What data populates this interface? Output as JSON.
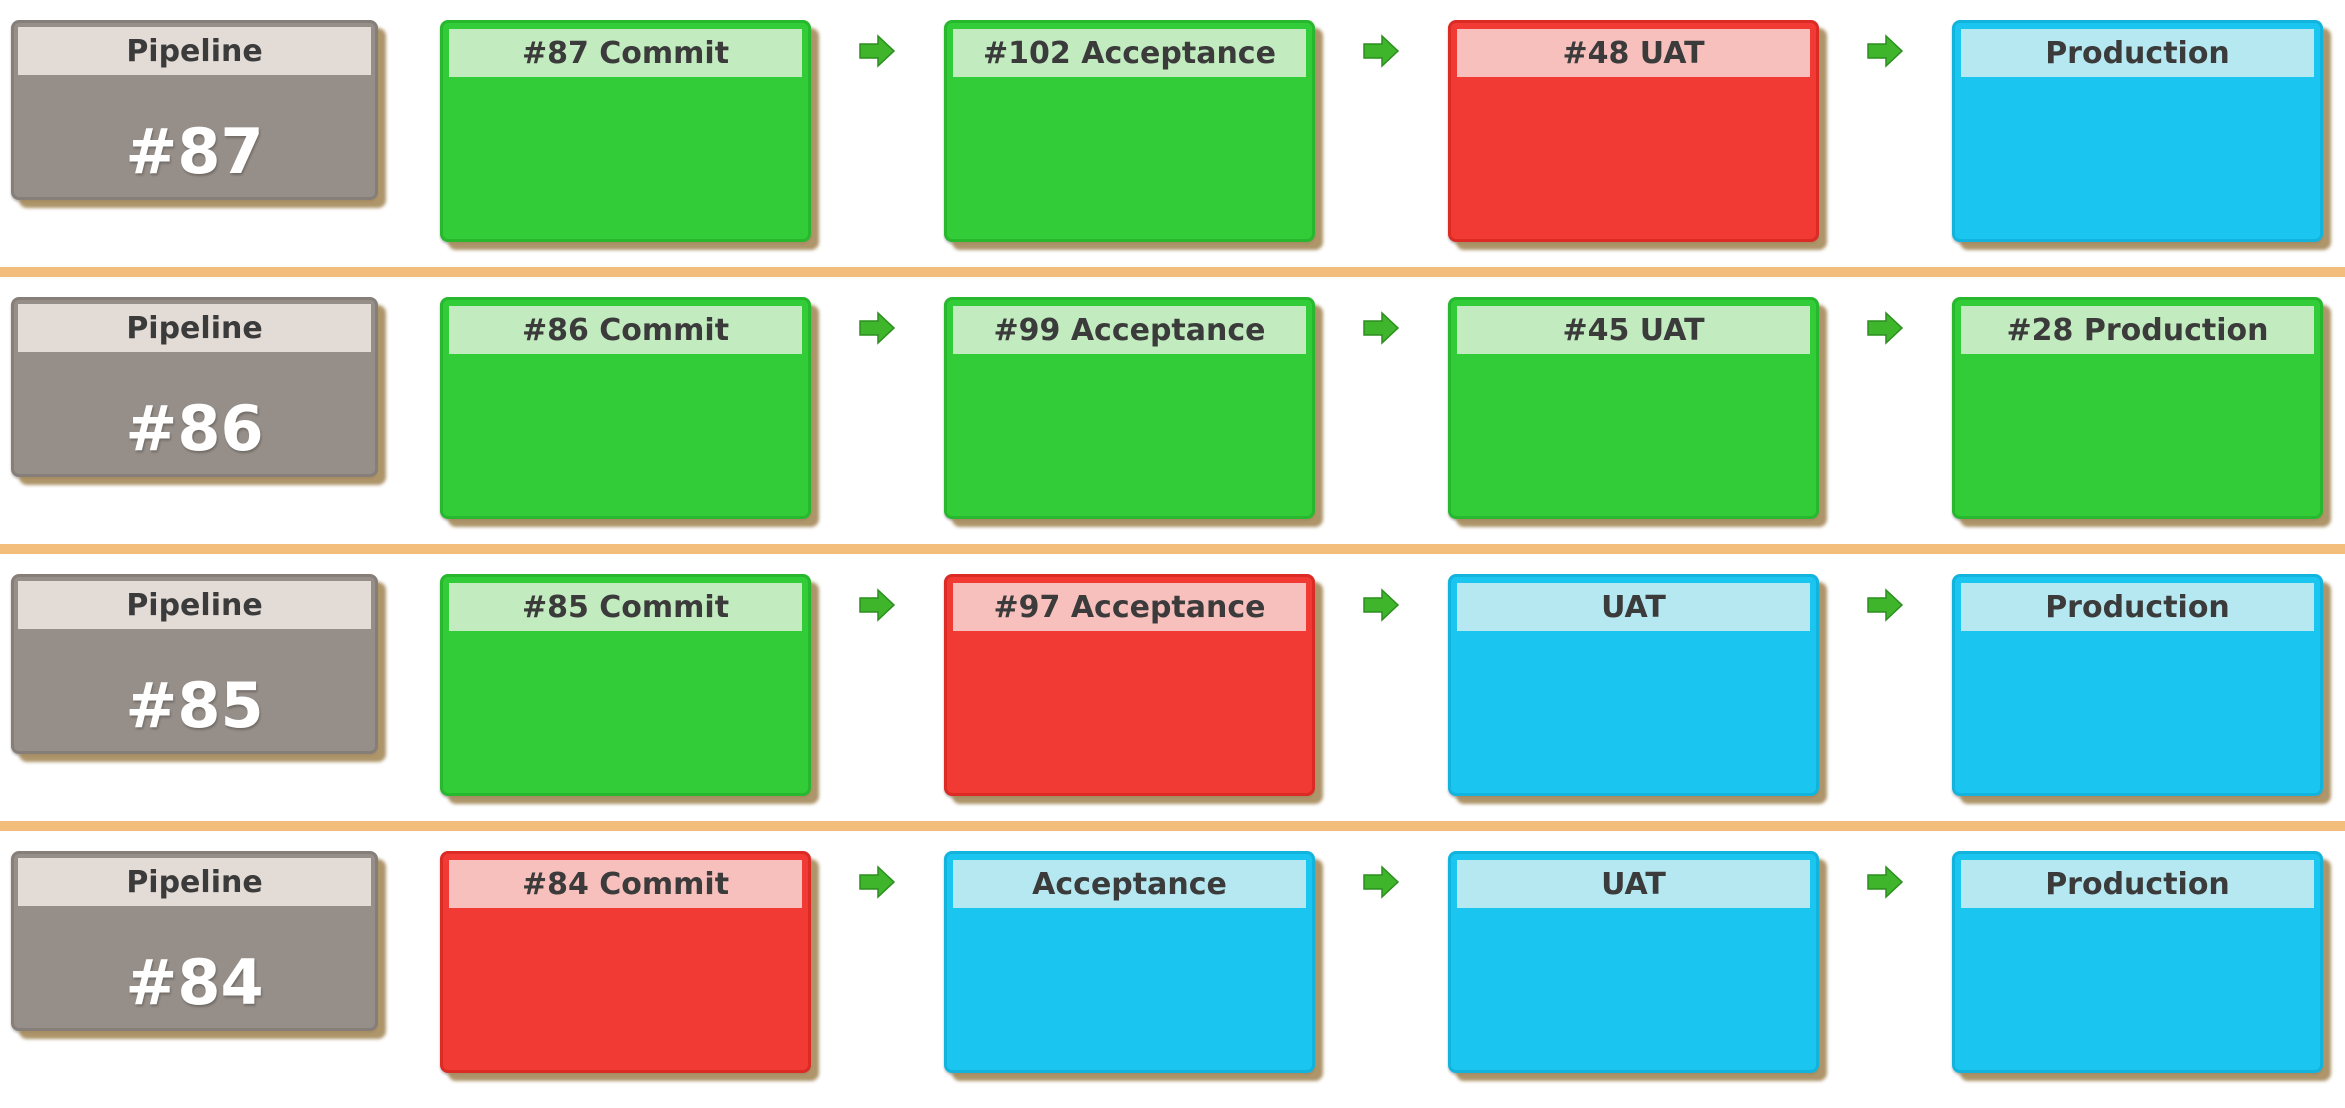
{
  "colors": {
    "passed": "#33cc39",
    "failed": "#f03a33",
    "pending": "#1ac6f0",
    "pipeline": "#968e88",
    "divider": "#f3bd7b",
    "arrow": "#3fb52c"
  },
  "rows": [
    {
      "pipeline_label": "Pipeline",
      "pipeline_number": "#87",
      "stages": [
        {
          "label": "#87 Commit",
          "status": "green"
        },
        {
          "label": "#102 Acceptance",
          "status": "green"
        },
        {
          "label": "#48 UAT",
          "status": "red"
        },
        {
          "label": "Production",
          "status": "blue"
        }
      ]
    },
    {
      "pipeline_label": "Pipeline",
      "pipeline_number": "#86",
      "stages": [
        {
          "label": "#86 Commit",
          "status": "green"
        },
        {
          "label": "#99 Acceptance",
          "status": "green"
        },
        {
          "label": "#45 UAT",
          "status": "green"
        },
        {
          "label": "#28 Production",
          "status": "green"
        }
      ]
    },
    {
      "pipeline_label": "Pipeline",
      "pipeline_number": "#85",
      "stages": [
        {
          "label": "#85 Commit",
          "status": "green"
        },
        {
          "label": "#97 Acceptance",
          "status": "red"
        },
        {
          "label": "UAT",
          "status": "blue"
        },
        {
          "label": "Production",
          "status": "blue"
        }
      ]
    },
    {
      "pipeline_label": "Pipeline",
      "pipeline_number": "#84",
      "stages": [
        {
          "label": "#84 Commit",
          "status": "red"
        },
        {
          "label": "Acceptance",
          "status": "blue"
        },
        {
          "label": "UAT",
          "status": "blue"
        },
        {
          "label": "Production",
          "status": "blue"
        }
      ]
    }
  ]
}
